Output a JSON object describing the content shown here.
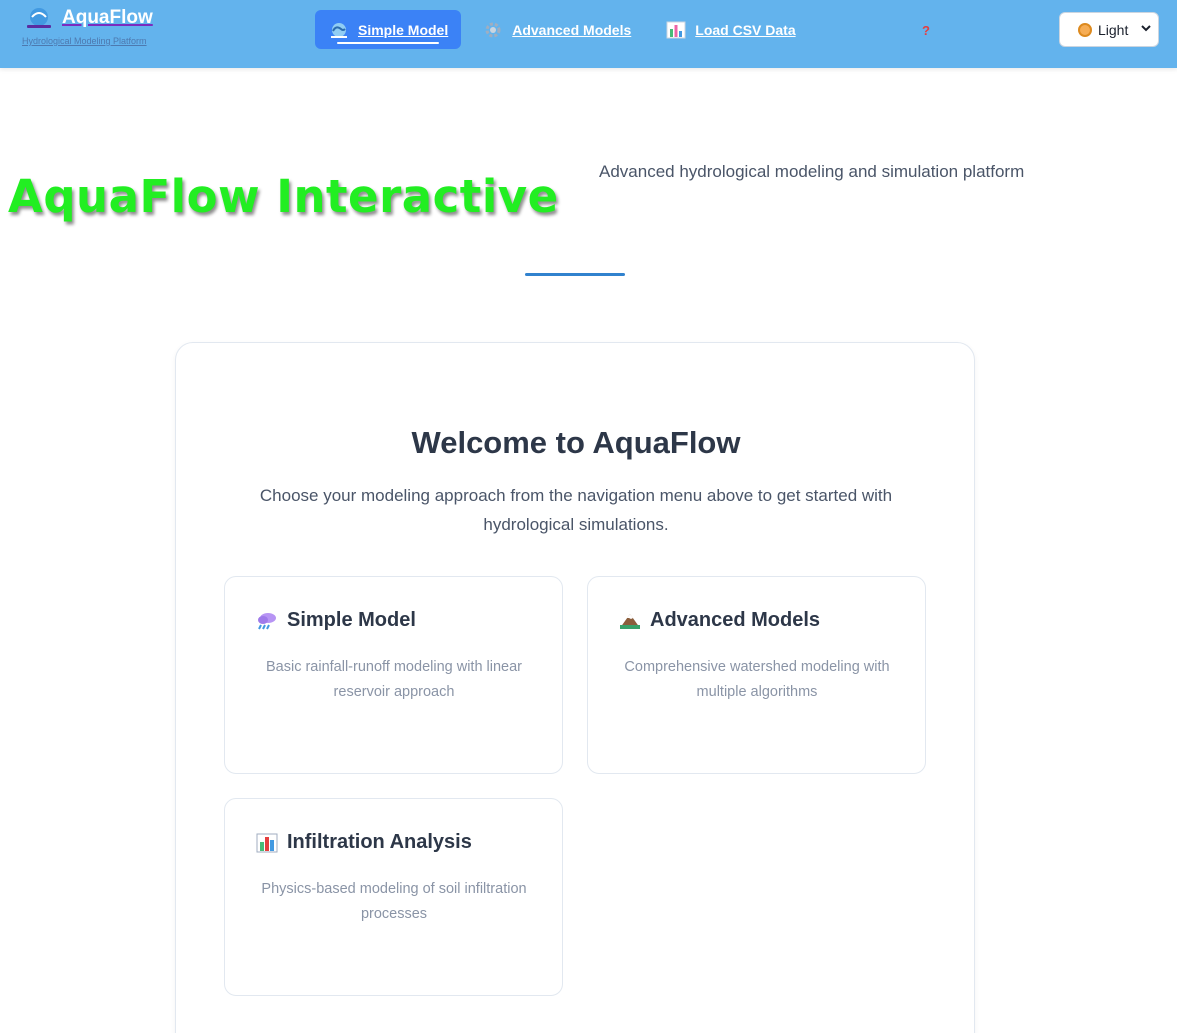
{
  "navbar": {
    "brand_title": "AquaFlow",
    "brand_subtitle": "Hydrological Modeling Platform",
    "links": [
      {
        "label": "Simple Model",
        "icon": "wave-icon",
        "active": true
      },
      {
        "label": "Advanced Models",
        "icon": "gear-icon",
        "active": false
      },
      {
        "label": "Load CSV Data",
        "icon": "bar-chart-icon",
        "active": false
      }
    ],
    "help_label": "?",
    "theme": {
      "selected": "Light",
      "icon": "sun-icon"
    }
  },
  "hero": {
    "title": "AquaFlow Interactive",
    "subtitle": "Advanced hydrological modeling and simulation platform"
  },
  "welcome": {
    "title": "Welcome to AquaFlow",
    "text": "Choose your modeling approach from the navigation menu above to get started with hydrological simulations.",
    "features": [
      {
        "title": "Simple Model",
        "icon": "rain-cloud-icon",
        "description": "Basic rainfall-runoff modeling with linear reservoir approach"
      },
      {
        "title": "Advanced Models",
        "icon": "mountain-icon",
        "description": "Comprehensive watershed modeling with multiple algorithms"
      },
      {
        "title": "Infiltration Analysis",
        "icon": "bar-chart-icon",
        "description": "Physics-based modeling of soil infiltration processes"
      }
    ]
  },
  "colors": {
    "navbar_bg": "#63b3ed",
    "active_tab": "#3b82f6",
    "hero_title": "#22ee22",
    "divider": "#3182ce"
  }
}
